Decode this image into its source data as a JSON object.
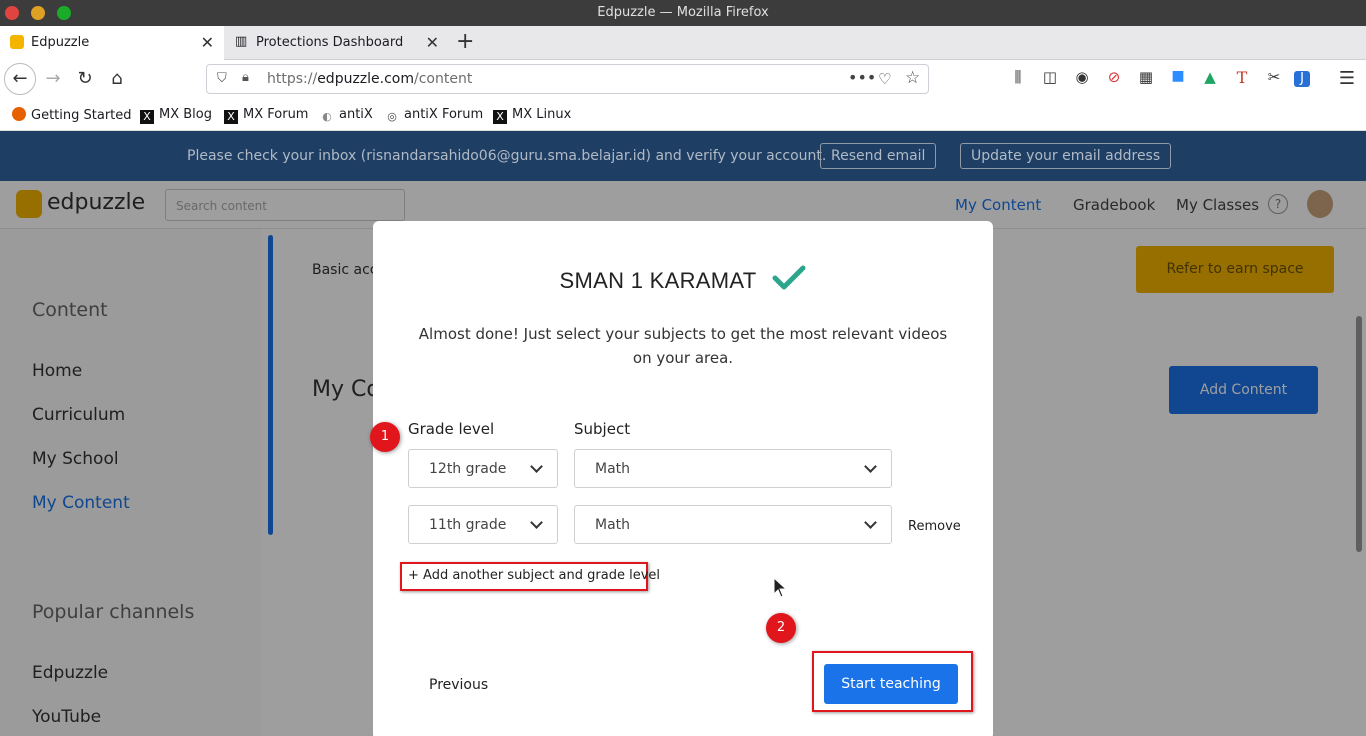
{
  "window": {
    "title": "Edpuzzle — Mozilla Firefox"
  },
  "tabs": [
    {
      "label": "Edpuzzle",
      "active": true
    },
    {
      "label": "Protections Dashboard",
      "active": false
    }
  ],
  "urlbar": {
    "prefix": "https://",
    "domain": "edpuzzle.com",
    "path": "/content"
  },
  "bookmarks": [
    "Getting Started",
    "MX Blog",
    "MX Forum",
    "antiX",
    "antiX Forum",
    "MX Linux"
  ],
  "banner": {
    "message": "Please check your inbox (risnandarsahido06@guru.sma.belajar.id) and verify your account.",
    "resend": "Resend email",
    "update": "Update your email address"
  },
  "app": {
    "logo": "edpuzzle",
    "search_placeholder": "Search content",
    "nav": [
      "My Content",
      "Gradebook",
      "My Classes"
    ]
  },
  "sidebar": {
    "content_head": "Content",
    "items": [
      "Home",
      "Curriculum",
      "My School",
      "My Content"
    ],
    "channels_head": "Popular channels",
    "channels": [
      "Edpuzzle",
      "YouTube"
    ]
  },
  "main": {
    "basic": "Basic account",
    "refer": "Refer to earn space",
    "heading": "My Content",
    "add": "Add Content"
  },
  "modal": {
    "school": "SMAN 1 KARAMAT",
    "description": "Almost done! Just select your subjects to get the most relevant videos on your area.",
    "grade_label": "Grade level",
    "subject_label": "Subject",
    "rows": [
      {
        "grade": "12th grade",
        "subject": "Math"
      },
      {
        "grade": "11th grade",
        "subject": "Math",
        "remove": "Remove"
      }
    ],
    "add_link": "+ Add another subject and grade level",
    "previous": "Previous",
    "start": "Start teaching"
  },
  "annotations": [
    "1",
    "2"
  ],
  "colors": {
    "accent": "#1a73e8",
    "banner": "#1f3e63",
    "highlight": "#e0161c",
    "check": "#2ca58d"
  }
}
